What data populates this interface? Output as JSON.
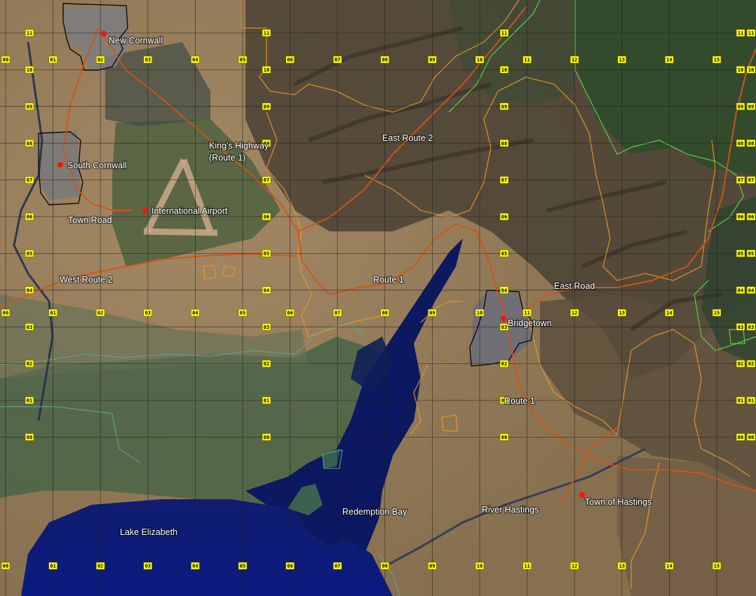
{
  "map": {
    "colors": {
      "land": "#8c7556",
      "land_light": "#a98c66",
      "mountain_dark": "#3f3a2f",
      "vegetation": "#4f6a45",
      "forest": "#2e4a2b",
      "water": "#0d1a66",
      "water_deep": "#071048",
      "river": "#2b3550",
      "road": "#d2541c",
      "orange_boundary": "#e69a2e",
      "green_boundary": "#5fdc4a",
      "teal_boundary": "#5fa992",
      "town_boundary": "#111111",
      "grid": "#2a2a2a",
      "grid_label_bg": "#ffff00",
      "place_marker": "#ff1010",
      "label_text": "#ffffff"
    },
    "grid_columns": [
      "00",
      "01",
      "02",
      "03",
      "04",
      "05",
      "06",
      "07",
      "08",
      "09",
      "10",
      "11",
      "12",
      "13",
      "14",
      "15"
    ],
    "grid_rows": [
      "11",
      "10",
      "09",
      "08",
      "07",
      "06",
      "05",
      "04",
      "03",
      "02",
      "01",
      "00"
    ],
    "places": [
      {
        "id": "new-cornwall",
        "label": "New Cornwall",
        "marker": true
      },
      {
        "id": "south-cornwall",
        "label": "South Cornwall",
        "marker": true
      },
      {
        "id": "international-airport",
        "label": "International Airport",
        "marker": true
      },
      {
        "id": "bridgetown",
        "label": "Bridgetown",
        "marker": true
      },
      {
        "id": "town-of-hastings",
        "label": "Town of Hastings",
        "marker": true
      }
    ],
    "road_labels": [
      {
        "id": "kings-highway",
        "lines": [
          "King's Highway",
          "(Route 1)"
        ]
      },
      {
        "id": "east-route-2",
        "lines": [
          "East Route 2"
        ]
      },
      {
        "id": "town-road",
        "lines": [
          "Town Road"
        ]
      },
      {
        "id": "west-route-2",
        "lines": [
          "West Route 2"
        ]
      },
      {
        "id": "route-1-north",
        "lines": [
          "Route 1"
        ]
      },
      {
        "id": "east-road",
        "lines": [
          "East Road"
        ]
      },
      {
        "id": "route-1-south",
        "lines": [
          "Route 1"
        ]
      }
    ],
    "water_labels": [
      {
        "id": "lake-elizabeth",
        "label": "Lake Elizabeth"
      },
      {
        "id": "redemption-bay",
        "label": "Redemption Bay"
      },
      {
        "id": "river-hastings",
        "label": "River Hastings"
      }
    ]
  }
}
